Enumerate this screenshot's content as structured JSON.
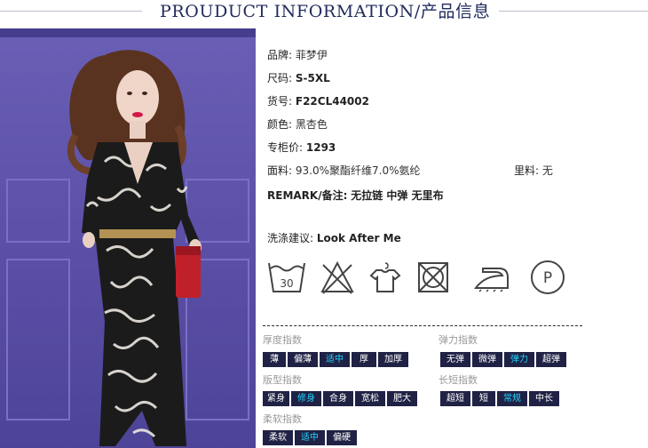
{
  "header": {
    "title": "PROUDUCT INFORMATION/产品信息"
  },
  "info": {
    "brand_label": "品牌:",
    "brand_value": "菲梦伊",
    "size_label": "尺码:",
    "size_value": "S-5XL",
    "sku_label": "货号:",
    "sku_value": "F22CL44002",
    "color_label": "颜色:",
    "color_value": "黑杏色",
    "price_label": "专柜价:",
    "price_value": "1293",
    "fabric_label": "面料:",
    "fabric_value": "93.0%聚酯纤维7.0%氨纶",
    "lining_label": "里料:",
    "lining_value": "无",
    "remark_label": "REMARK/备注:",
    "remark_value": "无拉链 中弹 无里布",
    "wash_label": "洗涤建议:",
    "wash_value": "Look After Me"
  },
  "care": {
    "icons": [
      "wash-30-icon",
      "no-bleach-icon",
      "hang-dry-icon",
      "no-tumble-dry-icon",
      "iron-icon",
      "dry-clean-p-icon"
    ],
    "wash_temp": "30",
    "dry_clean_letter": "P"
  },
  "indexes": {
    "thickness": {
      "title": "厚度指数",
      "options": [
        "薄",
        "偏薄",
        "适中",
        "厚",
        "加厚"
      ],
      "selected": "适中"
    },
    "elasticity": {
      "title": "弹力指数",
      "options": [
        "无弹",
        "微弹",
        "弹力",
        "超弹"
      ],
      "selected": "弹力"
    },
    "fit": {
      "title": "版型指数",
      "options": [
        "紧身",
        "修身",
        "合身",
        "宽松",
        "肥大"
      ],
      "selected": "修身"
    },
    "length": {
      "title": "长短指数",
      "options": [
        "超短",
        "短",
        "常规",
        "中长"
      ],
      "selected": "常规"
    },
    "softness": {
      "title": "柔软指数",
      "options": [
        "柔软",
        "适中",
        "偏硬"
      ],
      "selected": "适中"
    }
  },
  "colors": {
    "header_text": "#1f2a5c",
    "chip_bg": "#1f2244",
    "chip_active_text": "#23d4ff",
    "backdrop": "#5a4ea6",
    "dress_red_clutch": "#c0202a"
  }
}
